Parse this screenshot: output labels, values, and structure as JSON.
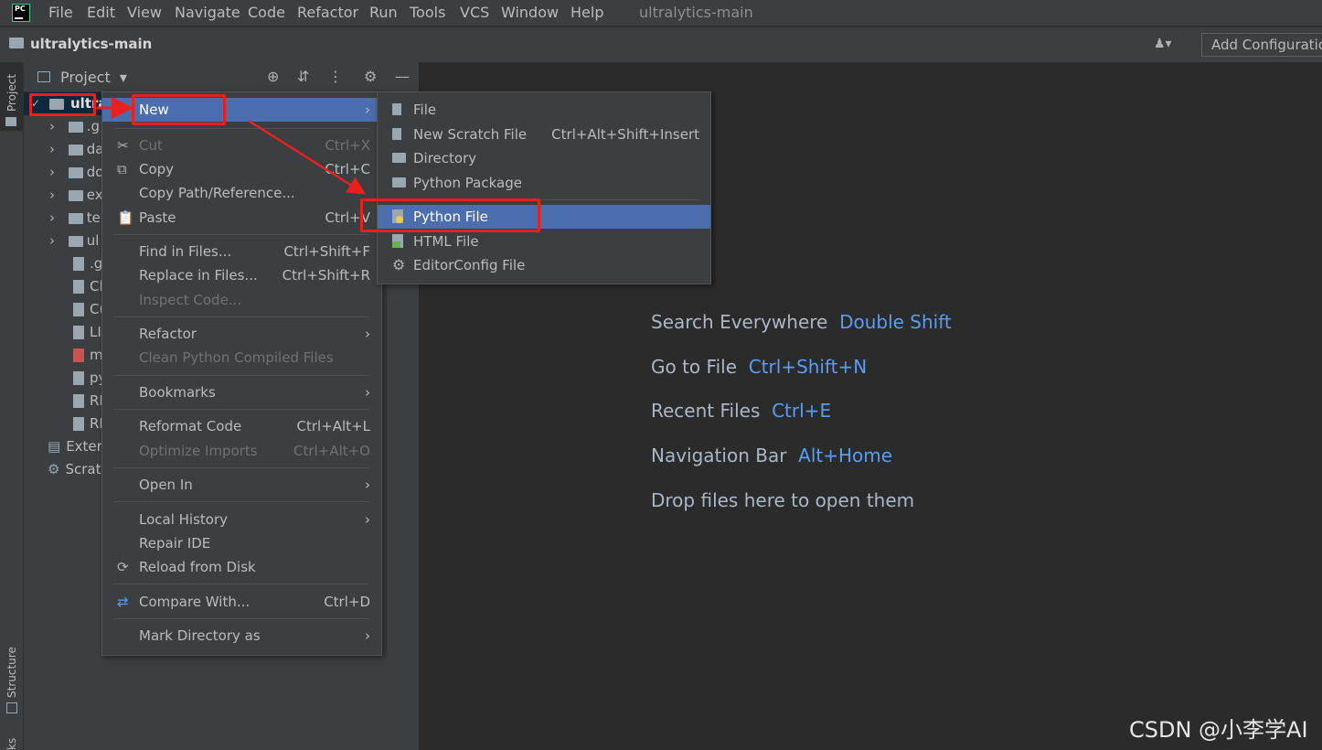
{
  "app": {
    "logo_text": "PC",
    "window_title": "ultralytics-main"
  },
  "menubar": {
    "items": [
      "File",
      "Edit",
      "View",
      "Navigate",
      "Code",
      "Refactor",
      "Run",
      "Tools",
      "VCS",
      "Window",
      "Help"
    ]
  },
  "navbar": {
    "project": "ultralytics-main",
    "add_configuration": "Add Configuration..."
  },
  "left_strip": {
    "project_tab": "Project",
    "structure_tab": "Structure",
    "bookmarks_tab": "ks"
  },
  "project_panel": {
    "title": "Project",
    "root_label": "ultra",
    "tree": [
      ".g",
      "da",
      "do",
      "ex",
      "te",
      "ul",
      ".g",
      "Cl",
      "C(",
      "LI",
      "m",
      "py",
      "RI",
      "RI"
    ],
    "external": "Exter",
    "scratches": "Scrat"
  },
  "context_menu": {
    "new": "New",
    "cut": {
      "label": "Cut",
      "shortcut": "Ctrl+X"
    },
    "copy": {
      "label": "Copy",
      "shortcut": "Ctrl+C"
    },
    "copy_path": {
      "label": "Copy Path/Reference..."
    },
    "paste": {
      "label": "Paste",
      "shortcut": "Ctrl+V"
    },
    "find_in_files": {
      "label": "Find in Files...",
      "shortcut": "Ctrl+Shift+F"
    },
    "replace_in_files": {
      "label": "Replace in Files...",
      "shortcut": "Ctrl+Shift+R"
    },
    "inspect_code": {
      "label": "Inspect Code..."
    },
    "refactor": {
      "label": "Refactor"
    },
    "clean_python": {
      "label": "Clean Python Compiled Files"
    },
    "bookmarks": {
      "label": "Bookmarks"
    },
    "reformat": {
      "label": "Reformat Code",
      "shortcut": "Ctrl+Alt+L"
    },
    "optimize_imports": {
      "label": "Optimize Imports",
      "shortcut": "Ctrl+Alt+O"
    },
    "open_in": {
      "label": "Open In"
    },
    "local_history": {
      "label": "Local History"
    },
    "repair_ide": {
      "label": "Repair IDE"
    },
    "reload": {
      "label": "Reload from Disk"
    },
    "compare_with": {
      "label": "Compare With...",
      "shortcut": "Ctrl+D"
    },
    "mark_directory": {
      "label": "Mark Directory as"
    }
  },
  "new_submenu": {
    "file": "File",
    "scratch": {
      "label": "New Scratch File",
      "shortcut": "Ctrl+Alt+Shift+Insert"
    },
    "directory": "Directory",
    "python_package": "Python Package",
    "python_file": "Python File",
    "html_file": "HTML File",
    "editorconfig": "EditorConfig File"
  },
  "editor_hints": [
    {
      "label": "Search Everywhere",
      "key": "Double Shift"
    },
    {
      "label": "Go to File",
      "key": "Ctrl+Shift+N"
    },
    {
      "label": "Recent Files",
      "key": "Ctrl+E"
    },
    {
      "label": "Navigation Bar",
      "key": "Alt+Home"
    },
    {
      "label": "Drop files here to open them",
      "key": ""
    }
  ],
  "watermark": "CSDN @小李学AI",
  "colors": {
    "selection": "#4b6eaf",
    "annotation": "#e8201e",
    "hint_key": "#589df6"
  }
}
